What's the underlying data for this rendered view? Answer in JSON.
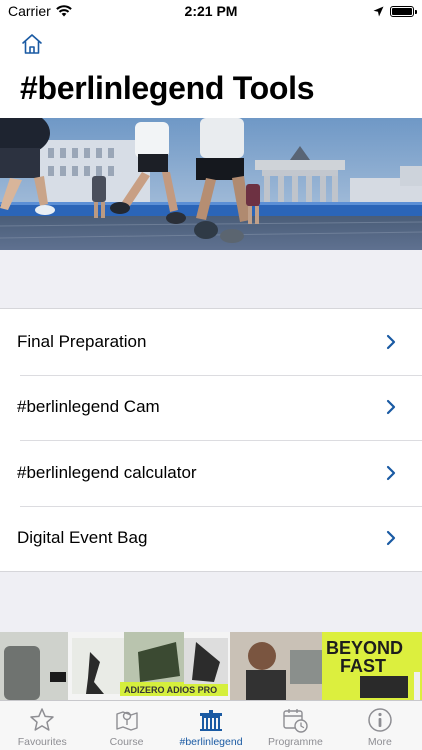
{
  "status_bar": {
    "carrier": "Carrier",
    "time": "2:21 PM"
  },
  "header": {
    "title": "#berlinlegend Tools"
  },
  "menu": {
    "items": [
      {
        "label": "Final Preparation"
      },
      {
        "label": "#berlinlegend Cam"
      },
      {
        "label": "#berlinlegend calculator"
      },
      {
        "label": "Digital Event Bag"
      }
    ]
  },
  "ad_banner": {
    "text_1": "ADIZERO ADIOS PRO",
    "text_2": "BEYOND",
    "text_3": "FAST"
  },
  "tab_bar": {
    "tabs": [
      {
        "label": "Favourites",
        "icon": "star-icon"
      },
      {
        "label": "Course",
        "icon": "map-icon"
      },
      {
        "label": "#berlinlegend",
        "icon": "brandenburg-gate-icon",
        "active": true
      },
      {
        "label": "Programme",
        "icon": "calendar-clock-icon"
      },
      {
        "label": "More",
        "icon": "info-icon"
      }
    ]
  },
  "colors": {
    "accent": "#1a5aa3",
    "background": "#efeff4",
    "inactive": "#8e8e93"
  }
}
